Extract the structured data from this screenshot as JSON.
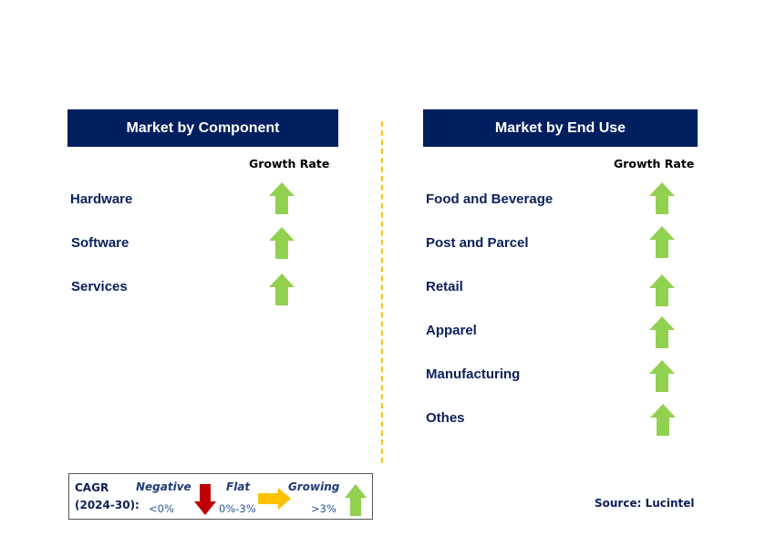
{
  "colors": {
    "header_bg": "#001f5f",
    "header_text": "#ffffff",
    "label_text": "#0b1f5c",
    "growing": "#92d050",
    "flat": "#ffc000",
    "negative": "#c00000",
    "divider": "#f5c21a"
  },
  "left_panel": {
    "title": "Market by Component",
    "growth_rate_label": "Growth Rate",
    "items": [
      {
        "label": "Hardware",
        "trend": "growing"
      },
      {
        "label": "Software",
        "trend": "growing"
      },
      {
        "label": "Services",
        "trend": "growing"
      }
    ]
  },
  "right_panel": {
    "title": "Market by End Use",
    "growth_rate_label": "Growth Rate",
    "items": [
      {
        "label": "Food and Beverage",
        "trend": "growing"
      },
      {
        "label": "Post and Parcel",
        "trend": "growing"
      },
      {
        "label": "Retail",
        "trend": "growing"
      },
      {
        "label": "Apparel",
        "trend": "growing"
      },
      {
        "label": "Manufacturing",
        "trend": "growing"
      },
      {
        "label": "Othes",
        "trend": "growing"
      }
    ]
  },
  "legend": {
    "title_line1": "CAGR",
    "title_line2": "(2024-30):",
    "negative": {
      "label": "Negative",
      "range": "<0%",
      "icon": "down-arrow-icon"
    },
    "flat": {
      "label": "Flat",
      "range": "0%-3%",
      "icon": "right-arrow-icon"
    },
    "growing": {
      "label": "Growing",
      "range": ">3%",
      "icon": "up-arrow-icon"
    }
  },
  "source": "Source: Lucintel"
}
